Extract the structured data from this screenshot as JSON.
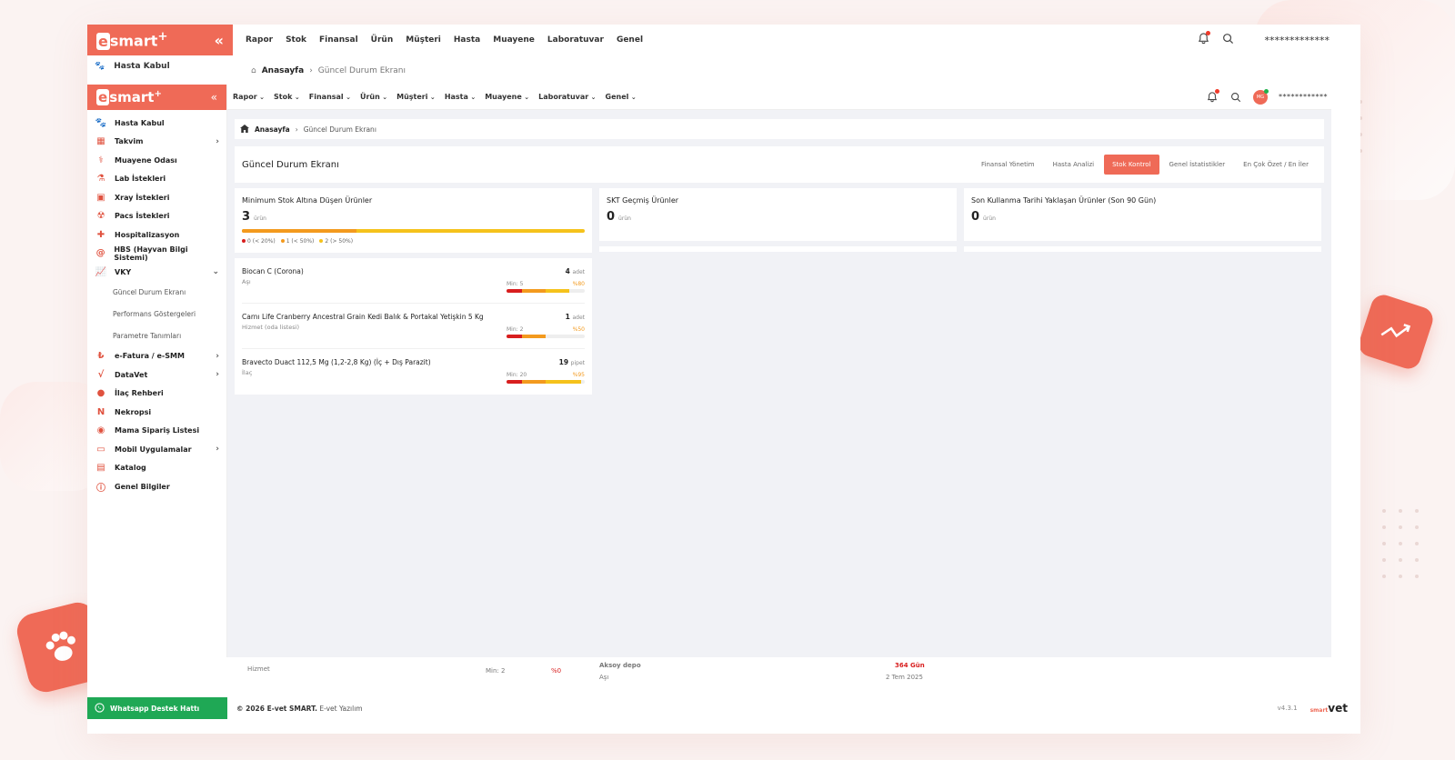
{
  "colors": {
    "brand": "#ef6a57",
    "whatsapp": "#1fa855",
    "critical": "#d81e1e",
    "warning": "#f39a1e",
    "ok": "#f5c21b"
  },
  "ghost": {
    "menu": [
      "Rapor",
      "Stok",
      "Finansal",
      "Ürün",
      "Müşteri",
      "Hasta",
      "Muayene",
      "Laboratuvar",
      "Genel"
    ],
    "username": "*************",
    "breadcrumb_home": "Anasayfa",
    "breadcrumb_current": "Güncel Durum Ekranı",
    "side_item": "Hasta Kabul",
    "rows": {
      "hizmet": "Hizmet",
      "min": "Min: 2",
      "pct": "%0",
      "depot": "Aksoy depo",
      "days": "364 Gün",
      "category": "Aşı",
      "date": "2 Tem 2025"
    }
  },
  "logo": {
    "text": "smart",
    "plus": "+"
  },
  "sidebar": {
    "items": [
      {
        "label": "Hasta Kabul",
        "icon": "paw-icon",
        "glyph": "🐾",
        "chevron": ""
      },
      {
        "label": "Takvim",
        "icon": "calendar-icon",
        "glyph": "▦",
        "chevron": "›"
      },
      {
        "label": "Muayene Odası",
        "icon": "stethoscope-icon",
        "glyph": "⚕",
        "chevron": ""
      },
      {
        "label": "Lab İstekleri",
        "icon": "flask-icon",
        "glyph": "⚗",
        "chevron": ""
      },
      {
        "label": "Xray İstekleri",
        "icon": "xray-icon",
        "glyph": "▣",
        "chevron": ""
      },
      {
        "label": "Pacs İstekleri",
        "icon": "radiation-icon",
        "glyph": "☢",
        "chevron": ""
      },
      {
        "label": "Hospitalizasyon",
        "icon": "hospital-icon",
        "glyph": "✚",
        "chevron": ""
      },
      {
        "label": "HBS (Hayvan Bilgi Sistemi)",
        "icon": "at-icon",
        "glyph": "@",
        "chevron": ""
      },
      {
        "label": "VKY",
        "icon": "chart-icon",
        "glyph": "📈",
        "chevron": "⌄"
      }
    ],
    "sub_items": [
      "Güncel Durum Ekranı",
      "Performans Göstergeleri",
      "Parametre Tanımları"
    ],
    "items2": [
      {
        "label": "e-Fatura / e-SMM",
        "icon": "invoice-icon",
        "glyph": "₺",
        "chevron": "›"
      },
      {
        "label": "DataVet",
        "icon": "data-icon",
        "glyph": "√",
        "chevron": "›"
      },
      {
        "label": "İlaç Rehberi",
        "icon": "pill-icon",
        "glyph": "●",
        "chevron": ""
      },
      {
        "label": "Nekropsi",
        "icon": "nekropsi-icon",
        "glyph": "N",
        "chevron": ""
      },
      {
        "label": "Mama Sipariş Listesi",
        "icon": "food-icon",
        "glyph": "◉",
        "chevron": ""
      },
      {
        "label": "Mobil Uygulamalar",
        "icon": "mobile-icon",
        "glyph": "▭",
        "chevron": "›"
      },
      {
        "label": "Katalog",
        "icon": "catalog-icon",
        "glyph": "▤",
        "chevron": ""
      },
      {
        "label": "Genel Bilgiler",
        "icon": "info-icon",
        "glyph": "ⓘ",
        "chevron": ""
      }
    ]
  },
  "topbar": {
    "menu": [
      "Rapor",
      "Stok",
      "Finansal",
      "Ürün",
      "Müşteri",
      "Hasta",
      "Muayene",
      "Laboratuvar",
      "Genel"
    ],
    "avatar_initials": "MG",
    "username": "************"
  },
  "breadcrumb": {
    "home": "Anasayfa",
    "current": "Güncel Durum Ekranı"
  },
  "page": {
    "title": "Güncel Durum Ekranı",
    "tabs": [
      {
        "label": "Finansal Yönetim",
        "active": false
      },
      {
        "label": "Hasta Analizi",
        "active": false
      },
      {
        "label": "Stok Kontrol",
        "active": true
      },
      {
        "label": "Genel İstatistikler",
        "active": false
      },
      {
        "label": "En Çok Özet / En İler",
        "active": false
      }
    ]
  },
  "cards": {
    "min_stock": {
      "title": "Minimum Stok Altına Düşen Ürünler",
      "count": "3",
      "unit": "ürün",
      "distribution": {
        "critical": 0,
        "warning": 1,
        "ok": 2
      },
      "legend": [
        "0 (< 20%)",
        "1 (< 50%)",
        "2 (> 50%)"
      ]
    },
    "skt": {
      "title": "SKT Geçmiş Ürünler",
      "count": "0",
      "unit": "ürün"
    },
    "expiring": {
      "title": "Son Kullanma Tarihi Yaklaşan Ürünler (Son 90 Gün)",
      "count": "0",
      "unit": "ürün"
    }
  },
  "products": [
    {
      "name": "Biocan C (Corona)",
      "category": "Aşı",
      "qty": "4",
      "unit": "adet",
      "min": "Min: 5",
      "pct": "%80",
      "level": 0.8
    },
    {
      "name": "Carnı Life Cranberry Ancestral Grain Kedi Balık & Portakal Yetişkin 5 Kg",
      "category": "Hizmet (oda listesi)",
      "qty": "1",
      "unit": "adet",
      "min": "Min: 2",
      "pct": "%50",
      "level": 0.5
    },
    {
      "name": "Bravecto Duact 112,5 Mg (1,2-2,8 Kg) (İç + Dış Parazit)",
      "category": "İlaç",
      "qty": "19",
      "unit": "pipet",
      "min": "Min: 20",
      "pct": "%95",
      "level": 0.95
    }
  ],
  "footer": {
    "whatsapp": "Whatsapp Destek Hattı",
    "copyright_bold": "© 2026 E-vet SMART.",
    "copyright_rest": "E-vet Yazılım",
    "version": "v4.3.1",
    "brand_small": "smart",
    "brand_big": "vet"
  }
}
